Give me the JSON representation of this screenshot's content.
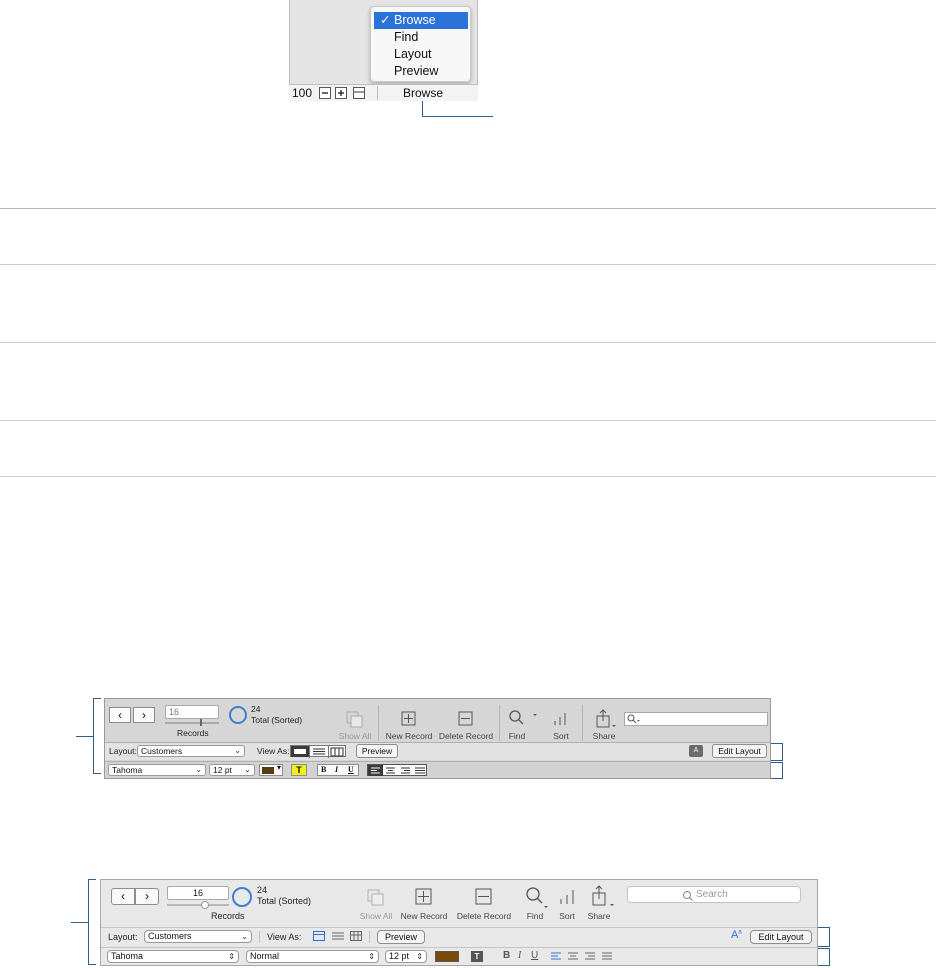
{
  "mode_popup": {
    "menu_items": [
      {
        "label": "Browse",
        "checkmark": "✓",
        "selected": true
      },
      {
        "label": "Find",
        "selected": false
      },
      {
        "label": "Layout",
        "selected": false
      },
      {
        "label": "Preview",
        "selected": false
      }
    ],
    "status_bar": {
      "zoom": "100",
      "mode_label": "Browse",
      "icons": [
        "zoom-out-icon",
        "zoom-in-icon",
        "toggle-toolbar-icon"
      ]
    }
  },
  "classic_toolbar": {
    "record_number": "16",
    "records_label": "Records",
    "total_count": "24",
    "total_label": "Total (Sorted)",
    "buttons": {
      "show_all": "Show All",
      "new_record": "New Record",
      "delete_record": "Delete Record",
      "find": "Find",
      "sort": "Sort",
      "share": "Share"
    },
    "layout_label": "Layout:",
    "layout_value": "Customers",
    "view_as_label": "View As:",
    "preview_button": "Preview",
    "edit_layout_button": "Edit Layout",
    "format_font": "Tahoma",
    "format_size": "12 pt",
    "bold": "B",
    "italic": "I",
    "underline": "U",
    "text_color": "#5a3a12",
    "highlight_color": "#f2ee1c",
    "highlight_glyph": "T",
    "accent_badge": "A"
  },
  "modern_toolbar": {
    "record_number": "16",
    "records_label": "Records",
    "total_count": "24",
    "total_label": "Total (Sorted)",
    "search_placeholder": "Search",
    "buttons": {
      "show_all": "Show All",
      "new_record": "New Record",
      "delete_record": "Delete Record",
      "find": "Find",
      "sort": "Sort",
      "share": "Share"
    },
    "layout_label": "Layout:",
    "layout_value": "Customers",
    "view_as_label": "View As:",
    "preview_button": "Preview",
    "edit_layout_button": "Edit Layout",
    "format_font": "Tahoma",
    "format_style": "Normal",
    "format_size": "12 pt",
    "bold": "B",
    "italic": "I",
    "underline": "U",
    "text_color": "#7a4a0a",
    "accent_color": "#2a73d9"
  }
}
